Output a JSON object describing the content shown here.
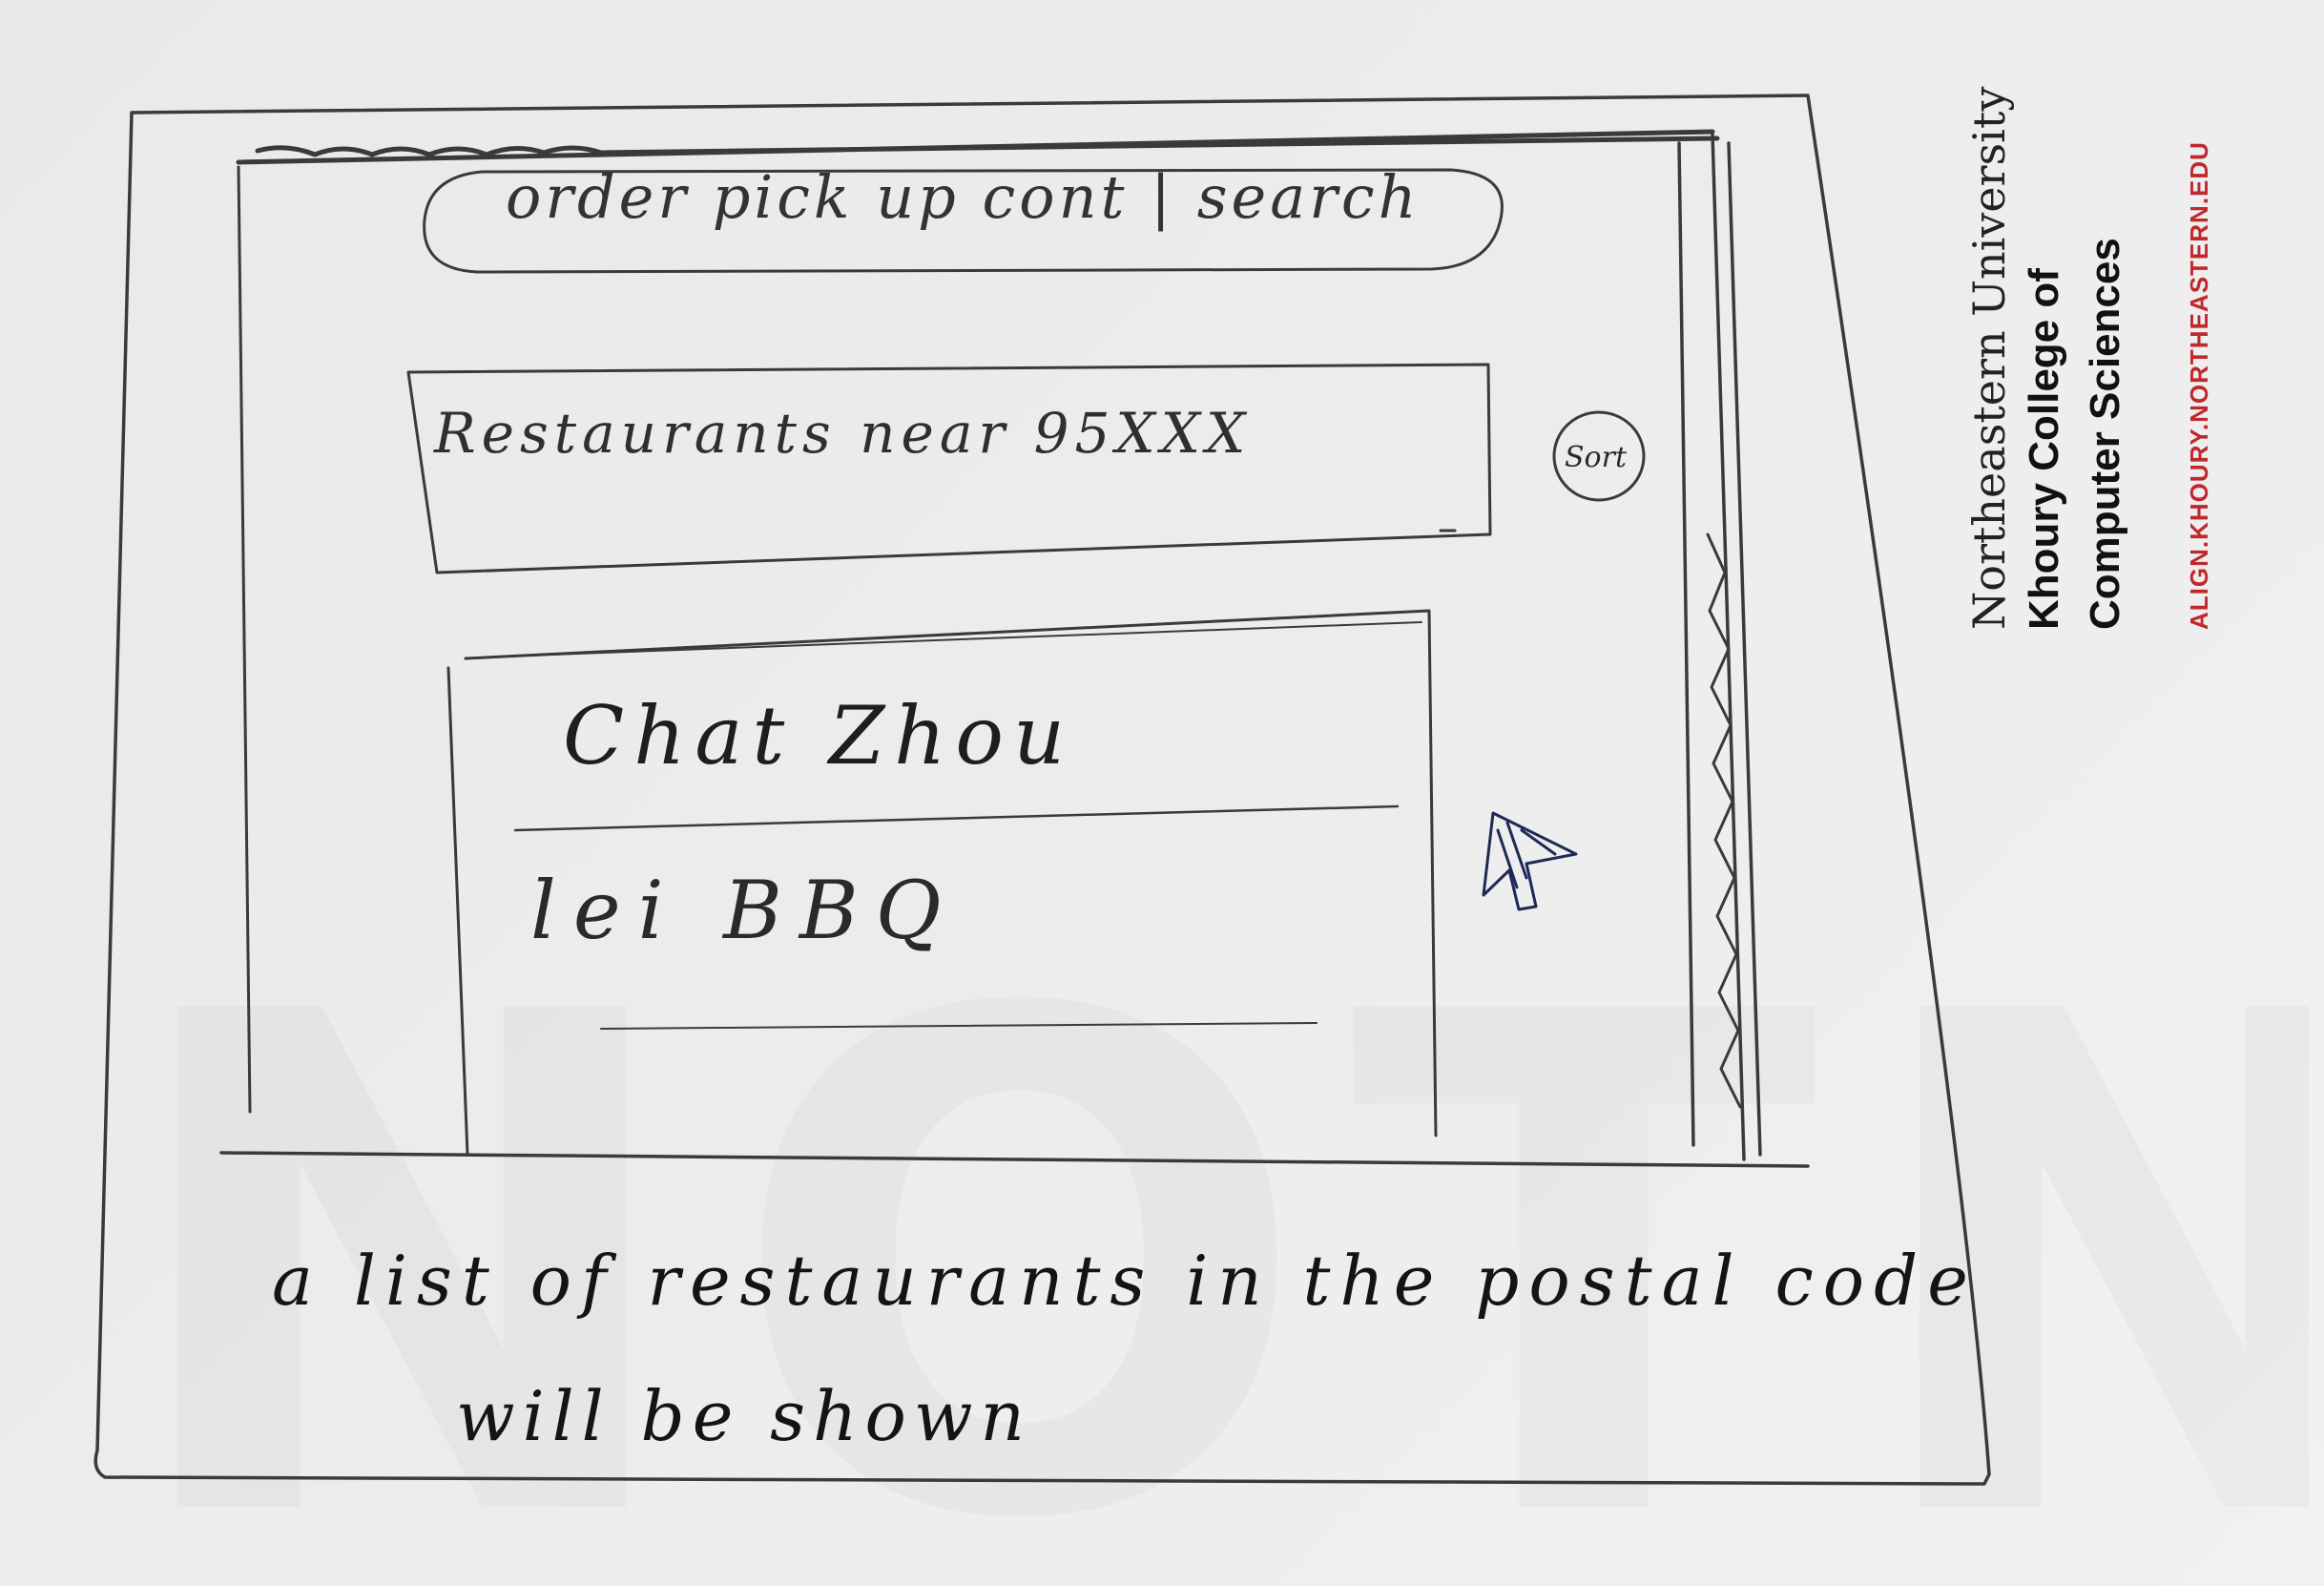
{
  "sketch": {
    "search_bar_text": "order pick up cont | search",
    "postal_field_text": "Restaurants near   95XXX",
    "sort_button_label": "Sort",
    "results": [
      {
        "name": "Chat Zhou"
      },
      {
        "name": "lei BBQ"
      }
    ],
    "caption_line1": "a list of restaurants in the postal code",
    "caption_line2": "will be shown"
  },
  "branding": {
    "university": "Northeastern University",
    "college_line1": "Khoury College of",
    "college_line2": "Computer Sciences",
    "url": "ALIGN.KHOURY.NORTHEASTERN.EDU",
    "accent_color": "#c0282d"
  },
  "icons": {
    "pointer": "mouse-cursor-icon"
  }
}
